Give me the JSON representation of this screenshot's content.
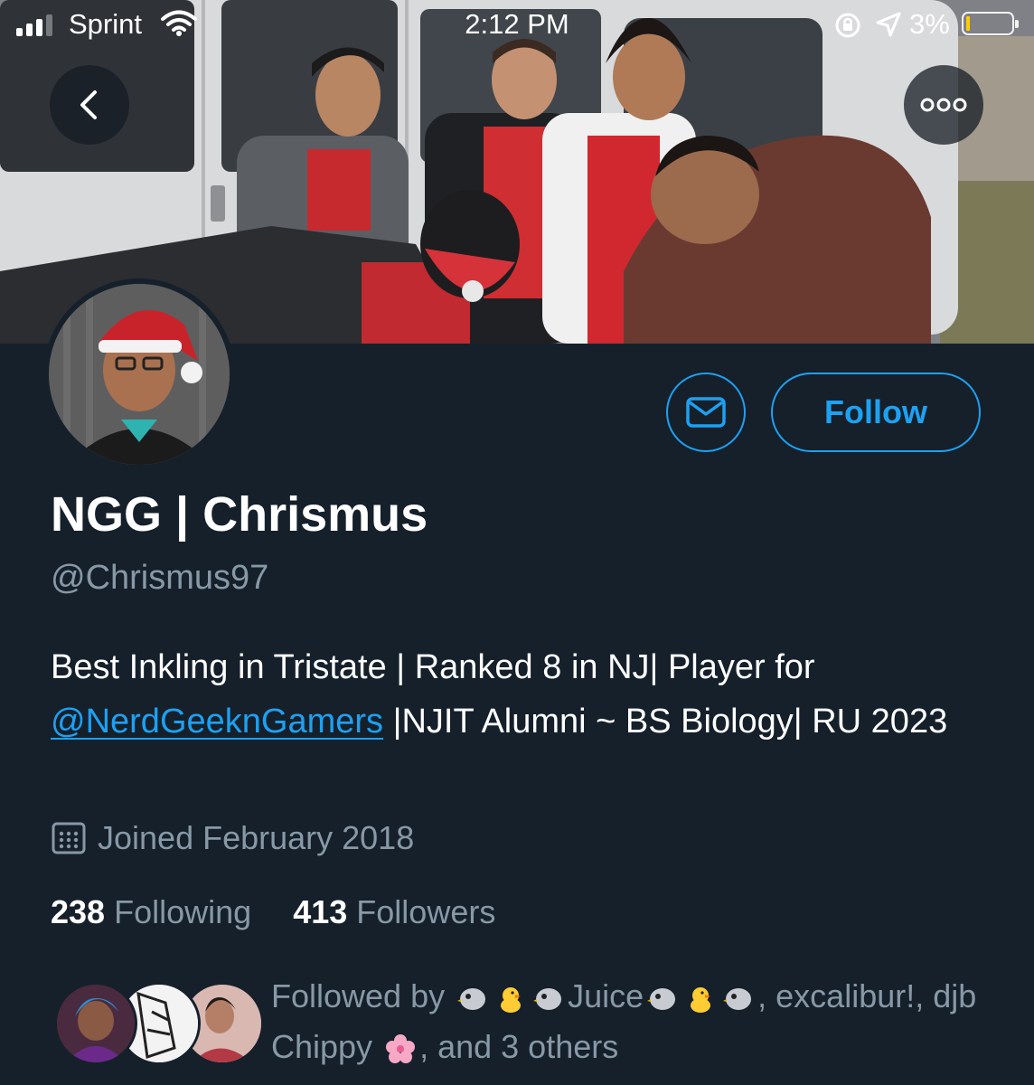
{
  "status_bar": {
    "carrier": "Sprint",
    "time": "2:12 PM",
    "battery_percent": "3%",
    "battery_level": 0.03
  },
  "profile": {
    "display_name": "NGG | Chrismus",
    "handle": "@Chrismus97",
    "bio_part1": "Best Inkling in Tristate | Ranked 8 in NJ| Player for ",
    "bio_mention": "@NerdGeeknGamers",
    "bio_part2": " |NJIT Alumni ~ BS Biology| RU 2023",
    "joined": "Joined February 2018",
    "following_count": "238",
    "following_label": "Following",
    "followers_count": "413",
    "followers_label": "Followers"
  },
  "actions": {
    "follow_label": "Follow"
  },
  "followed_by": {
    "prefix": "Followed by",
    "name1": "Juice",
    "rest": ", excalibur!, djb Chippy",
    "suffix": ", and 3 others"
  },
  "icons": {
    "back": "chevron-left-icon",
    "more": "more-icon",
    "message": "envelope-icon",
    "calendar": "calendar-icon"
  },
  "colors": {
    "background": "#15202b",
    "accent": "#1da1f2",
    "secondary_text": "#8899a6"
  }
}
